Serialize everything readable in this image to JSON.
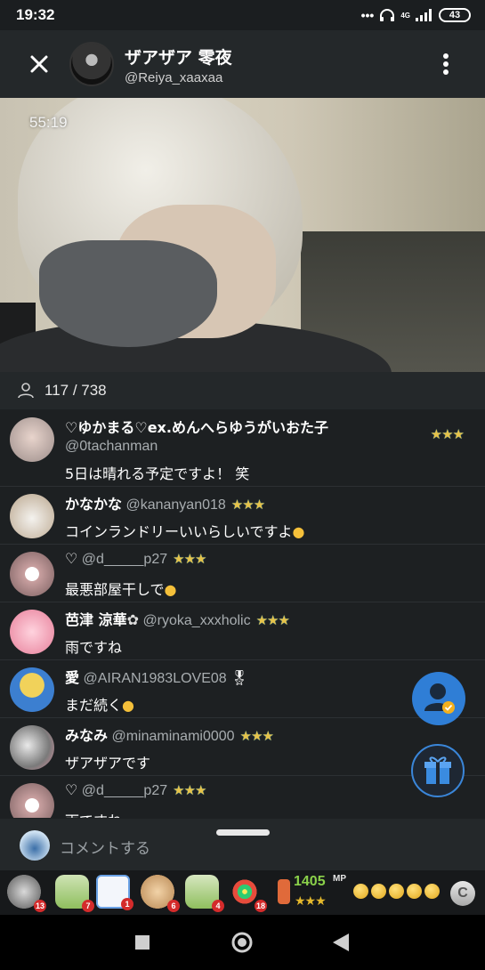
{
  "status_bar": {
    "time": "19:32",
    "network": "4G",
    "battery": "43"
  },
  "header": {
    "streamer_name": "ザアザア 零夜",
    "streamer_handle": "@Reiya_xaaxaa"
  },
  "video": {
    "timer": "55:19"
  },
  "viewers": {
    "count": "117 / 738"
  },
  "comments": [
    {
      "name": "♡ゆかまる♡ex.めんへらゆうがいおた子",
      "handle": "@0tachanman",
      "text": "5日は晴れる予定ですよ！ 笑",
      "badge": "★★★"
    },
    {
      "name": "かなかな",
      "handle": "@kananyan018",
      "text": "コインランドリーいいらしいですよ",
      "badge": "★★★"
    },
    {
      "name": "♡",
      "handle": "@d_____p27",
      "text": "最悪部屋干しで",
      "badge": "★★★"
    },
    {
      "name": "芭津  涼華",
      "handle": "@ryoka_xxxholic",
      "text": "雨ですね",
      "badge": "★★★"
    },
    {
      "name": "愛",
      "handle": "@AIRAN1983LOVE08",
      "text": "まだ続く",
      "badge": "🎖"
    },
    {
      "name": "みなみ",
      "handle": "@minaminami0000",
      "text": "ザアザアです",
      "badge": "★★★"
    },
    {
      "name": "♡",
      "handle": "@d_____p27",
      "text": "雨ですね",
      "badge": "★★★"
    }
  ],
  "comment_input": {
    "placeholder": "コメントする"
  },
  "gift_bar": {
    "counts": [
      "13",
      "7",
      "1",
      "6",
      "4",
      "18"
    ],
    "mp_value": "1405",
    "mp_label": "MP",
    "mp_stars": "★★★",
    "c_button": "C"
  },
  "colors": {
    "accent_blue": "#2f7ed6",
    "mp_green": "#8bd14a",
    "badge_gold": "#e6c34a"
  }
}
